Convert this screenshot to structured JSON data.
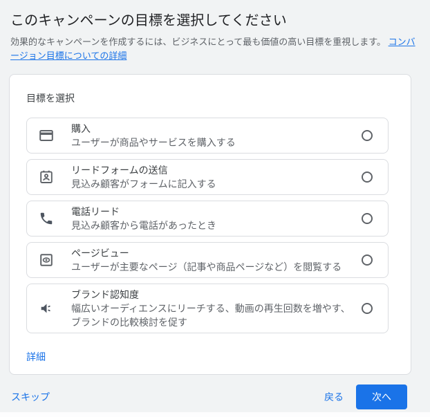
{
  "header": {
    "title": "このキャンペーンの目標を選択してください",
    "subtitle": "効果的なキャンペーンを作成するには、ビジネスにとって最も価値の高い目標を重視します。 ",
    "subtitle_link": "コンバージョン目標についての詳細"
  },
  "card": {
    "section_label": "目標を選択",
    "options": [
      {
        "icon": "credit-card-icon",
        "title": "購入",
        "description": "ユーザーが商品やサービスを購入する",
        "selected": false
      },
      {
        "icon": "lead-form-icon",
        "title": "リードフォームの送信",
        "description": "見込み顧客がフォームに記入する",
        "selected": false
      },
      {
        "icon": "phone-icon",
        "title": "電話リード",
        "description": "見込み顧客から電話があったとき",
        "selected": false
      },
      {
        "icon": "pageview-icon",
        "title": "ページビュー",
        "description": "ユーザーが主要なページ（記事や商品ページなど）を閲覧する",
        "selected": false
      },
      {
        "icon": "brand-awareness-icon",
        "title": "ブランド認知度",
        "description": "幅広いオーディエンスにリーチする、動画の再生回数を増やす、ブランドの比較検討を促す",
        "selected": false
      }
    ],
    "details_link": "詳細"
  },
  "footer": {
    "skip_label": "スキップ",
    "back_label": "戻る",
    "next_label": "次へ"
  },
  "colors": {
    "accent": "#1a73e8",
    "page_background": "#f1f3f4",
    "card_border": "#dadce0",
    "title_text": "#202124",
    "secondary_text": "#5f6368",
    "icon_color": "#5f6368"
  }
}
